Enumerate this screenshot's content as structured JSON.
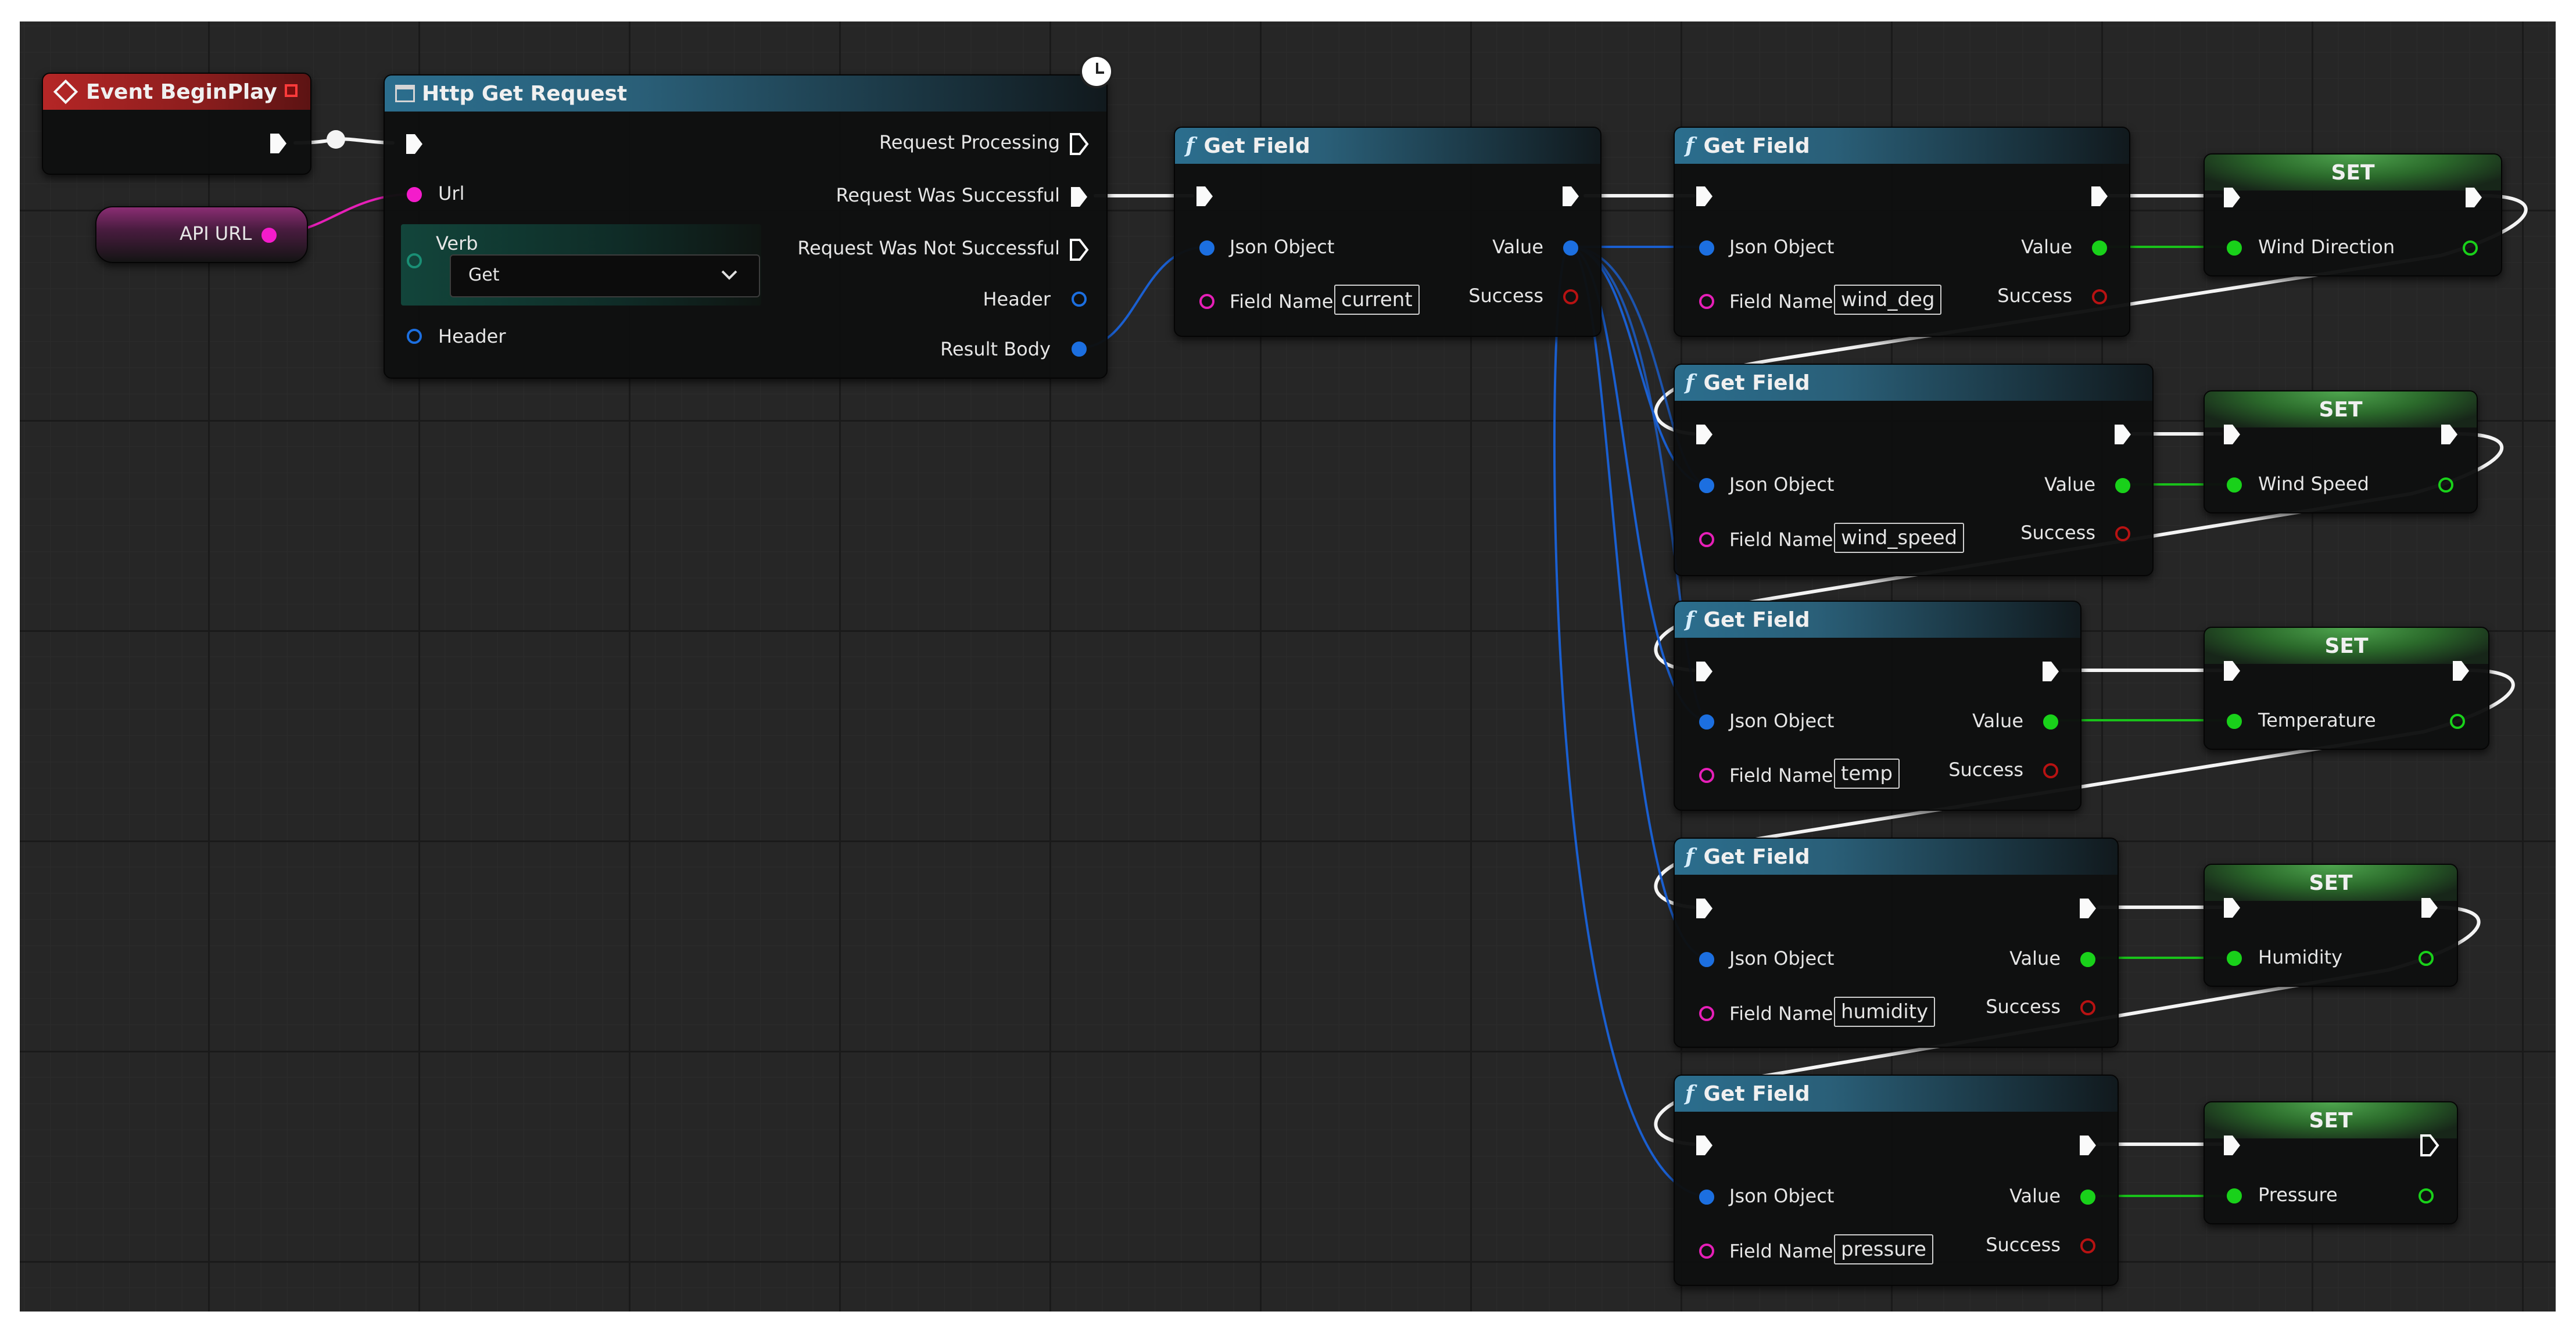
{
  "nodes": {
    "event_begin_play": {
      "title": "Event BeginPlay"
    },
    "api_url": {
      "label": "API URL"
    },
    "http_get": {
      "title": "Http Get Request",
      "url_label": "Url",
      "verb_label": "Verb",
      "verb_value": "Get",
      "header_in_label": "Header",
      "request_processing": "Request Processing",
      "request_successful": "Request Was Successful",
      "request_not_successful": "Request Was Not Successful",
      "header_out_label": "Header",
      "result_body": "Result Body"
    },
    "get_field_current": {
      "title": "Get Field",
      "json_object": "Json Object",
      "field_name_label": "Field Name",
      "field_name": "current",
      "value": "Value",
      "success": "Success"
    },
    "get_field_wind_deg": {
      "title": "Get Field",
      "json_object": "Json Object",
      "field_name_label": "Field Name",
      "field_name": "wind_deg",
      "value": "Value",
      "success": "Success"
    },
    "get_field_wind_speed": {
      "title": "Get Field",
      "json_object": "Json Object",
      "field_name_label": "Field Name",
      "field_name": "wind_speed",
      "value": "Value",
      "success": "Success"
    },
    "get_field_temp": {
      "title": "Get Field",
      "json_object": "Json Object",
      "field_name_label": "Field Name",
      "field_name": "temp",
      "value": "Value",
      "success": "Success"
    },
    "get_field_humidity": {
      "title": "Get Field",
      "json_object": "Json Object",
      "field_name_label": "Field Name",
      "field_name": "humidity",
      "value": "Value",
      "success": "Success"
    },
    "get_field_pressure": {
      "title": "Get Field",
      "json_object": "Json Object",
      "field_name_label": "Field Name",
      "field_name": "pressure",
      "value": "Value",
      "success": "Success"
    },
    "set_wind_direction": {
      "title": "SET",
      "var": "Wind Direction"
    },
    "set_wind_speed": {
      "title": "SET",
      "var": "Wind Speed"
    },
    "set_temperature": {
      "title": "SET",
      "var": "Temperature"
    },
    "set_humidity": {
      "title": "SET",
      "var": "Humidity"
    },
    "set_pressure": {
      "title": "SET",
      "var": "Pressure"
    }
  },
  "icons": {
    "function": "f-icon",
    "event": "event-diamond-icon",
    "clock": "clock-icon",
    "window": "window-icon"
  },
  "colors": {
    "exec_wire": "#ffffff",
    "object_wire": "#1a5fd0",
    "string_wire": "#e61fb8",
    "value_wire": "#19c21a"
  }
}
